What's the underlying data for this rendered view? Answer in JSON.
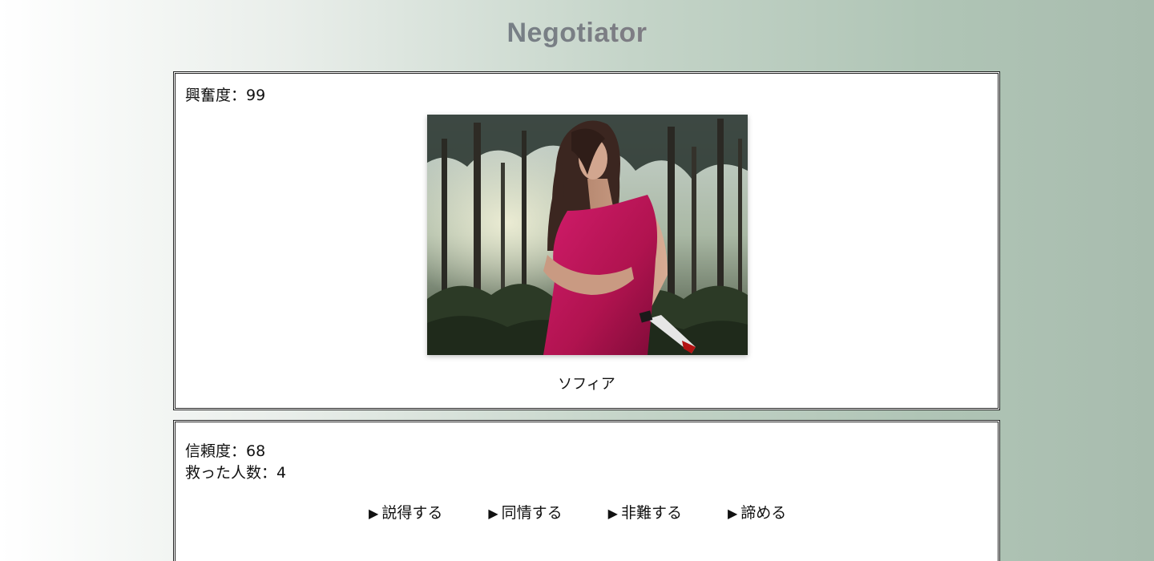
{
  "header": {
    "title": "Negotiator"
  },
  "target_panel": {
    "excitement_label": "興奮度",
    "excitement_value": "99",
    "character_name": "ソフィア",
    "photo": "woman-in-magenta-dress-holding-knife-in-forest"
  },
  "status_panel": {
    "trust_label": "信頼度",
    "trust_value": "68",
    "saved_label": "救った人数",
    "saved_value": "4"
  },
  "actions": [
    {
      "label": "説得する"
    },
    {
      "label": "同情する"
    },
    {
      "label": "非難する"
    },
    {
      "label": "諦める"
    }
  ],
  "colors": {
    "title_start": "#5e7d8a",
    "title_end": "#a06577",
    "dress": "#c0185e",
    "background_right": "#a8bcae"
  }
}
